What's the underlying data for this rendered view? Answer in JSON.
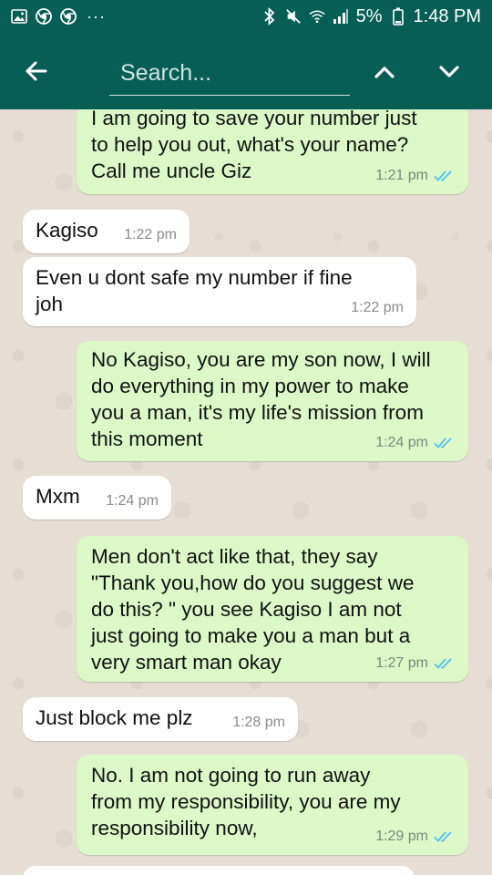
{
  "status_bar": {
    "left_icons": [
      "gallery-icon",
      "chrome-icon",
      "chrome-icon",
      "more-dots-icon"
    ],
    "dots": "···",
    "battery": "5%",
    "time": "1:48 PM"
  },
  "toolbar": {
    "search_placeholder": "Search..."
  },
  "colors": {
    "header": "#075e54",
    "outgoing_bubble": "#dcf8c6",
    "incoming_bubble": "#ffffff",
    "read_ticks": "#4fc3f7",
    "chat_background": "#e6ddd4"
  },
  "messages": [
    {
      "dir": "out",
      "text": "I am going to save your number just\nto help you out,  what's your name?\nCall me uncle Giz",
      "time": "1:21 pm",
      "status": "read"
    },
    {
      "dir": "in",
      "text": "Kagiso",
      "time": "1:22 pm"
    },
    {
      "dir": "in",
      "text": "Even u dont safe my number if fine\njoh",
      "time": "1:22 pm"
    },
    {
      "dir": "out",
      "text": "No Kagiso, you are my son now, I will\ndo everything in my power to make\nyou a man, it's my life's mission from\nthis moment",
      "time": "1:24 pm",
      "status": "read"
    },
    {
      "dir": "in",
      "text": "Mxm",
      "time": "1:24 pm"
    },
    {
      "dir": "out",
      "text": "Men don't act like that, they say\n\"Thank you,how do you suggest we\ndo this? \" you see Kagiso I am not\njust going to make you a  man but a\nvery smart man okay",
      "time": "1:27 pm",
      "status": "read"
    },
    {
      "dir": "in",
      "text": "Just block me plz",
      "time": "1:28 pm"
    },
    {
      "dir": "out",
      "text": "No. I am not going to run away\nfrom my responsibility, you are my\nresponsibility now,",
      "time": "1:29 pm",
      "status": "read"
    }
  ]
}
